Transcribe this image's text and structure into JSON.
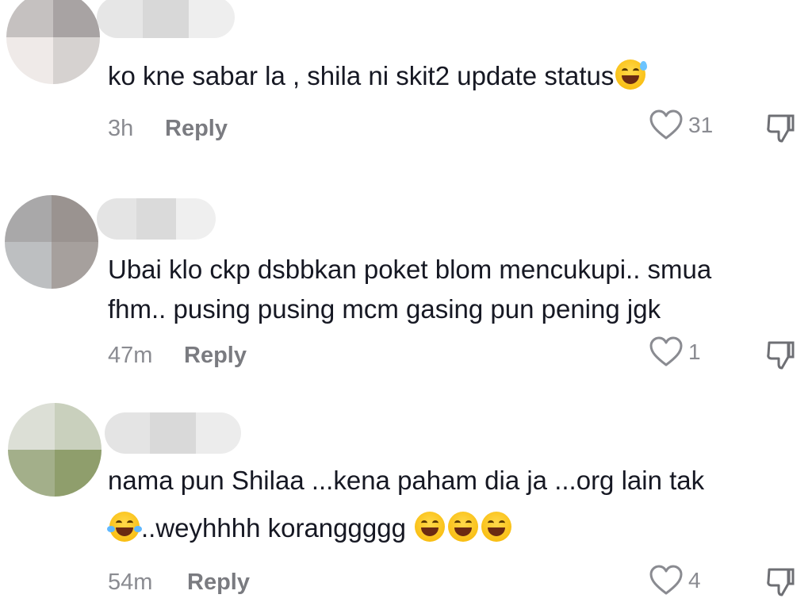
{
  "comments": [
    {
      "text": "ko kne sabar la , shila ni skit2 update status",
      "emoji_after": "sweat-smile-icon",
      "time": "3h",
      "reply_label": "Reply",
      "likes": "31"
    },
    {
      "text_line1": "Ubai klo ckp dsbbkan poket blom mencukupi.. smua",
      "text_line2": "fhm.. pusing pusing mcm gasing pun pening jgk",
      "time": "47m",
      "reply_label": "Reply",
      "likes": "1"
    },
    {
      "text_line1": "nama pun Shilaa ...kena paham dia ja ...org lain tak",
      "text_line2": "..weyhhhh koranggggg",
      "emojis": [
        "tears-of-joy-icon",
        "grinning-squint-icon",
        "grinning-squint-icon",
        "grinning-squint-icon"
      ],
      "time": "54m",
      "reply_label": "Reply",
      "likes": "4"
    }
  ],
  "colors": {
    "text": "#161823",
    "meta": "#8a8b91",
    "reply": "#7a7b80"
  }
}
